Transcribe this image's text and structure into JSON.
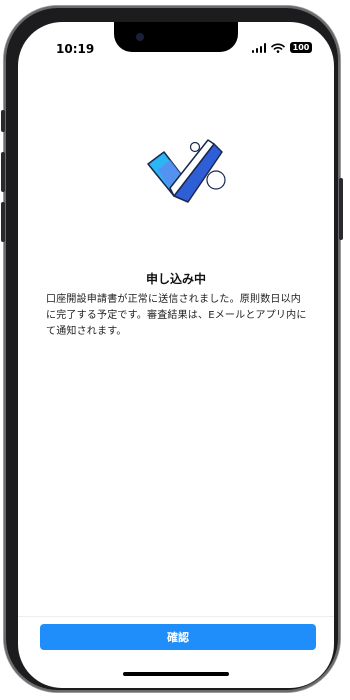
{
  "status_bar": {
    "time": "10:19",
    "battery": "100",
    "icons": [
      "signal-icon",
      "wifi-icon",
      "battery-icon"
    ]
  },
  "illustration": {
    "icon": "checkmark-illustration",
    "colors": {
      "dark_blue": "#2f5fd6",
      "light_blue": "#2bb5f5",
      "outline": "#1a2850"
    }
  },
  "content": {
    "title": "申し込み中",
    "message": "口座開設申請書が正常に送信されました。原則数日以内に完了する予定です。審査結果は、Eメールとアプリ内にて通知されます。"
  },
  "footer": {
    "confirm_label": "確認"
  },
  "colors": {
    "accent": "#1f8efa"
  }
}
